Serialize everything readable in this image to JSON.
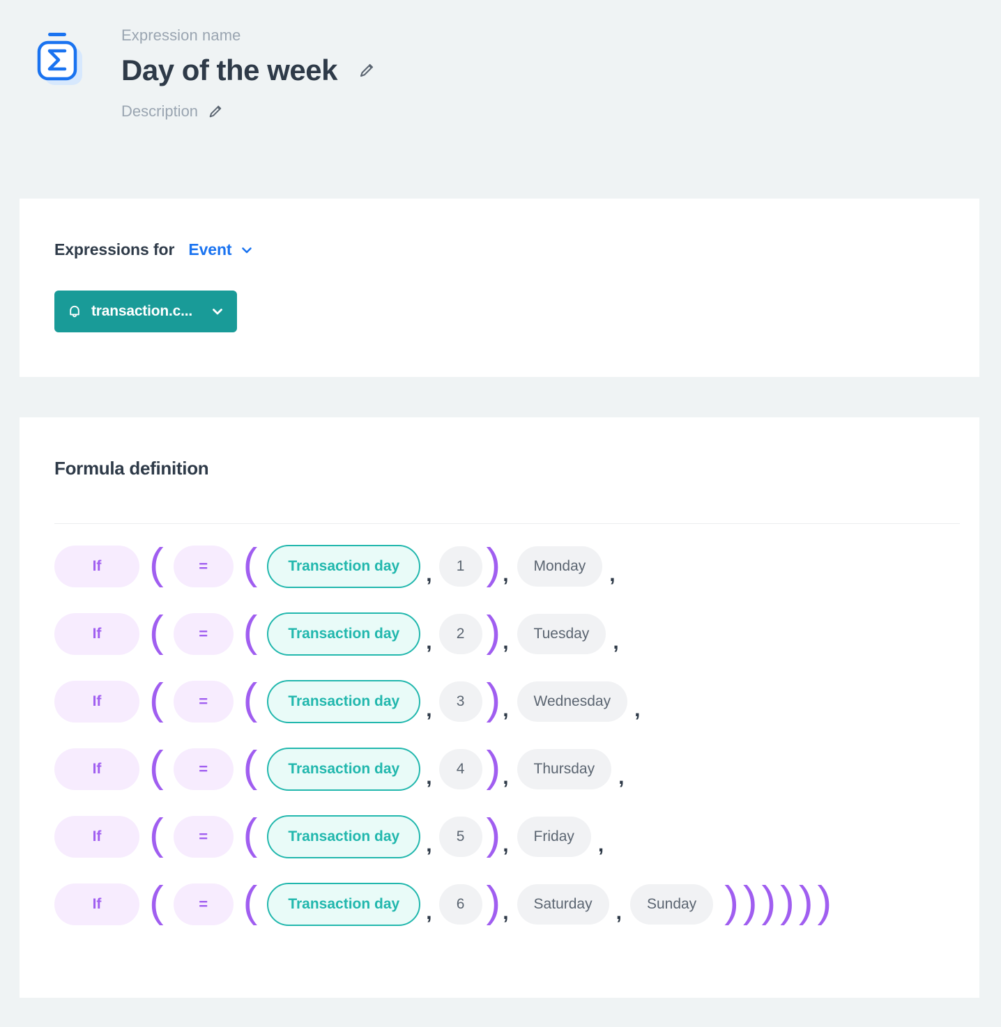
{
  "header": {
    "icon_name": "sigma-expression-icon",
    "expression_name_label": "Expression name",
    "title": "Day of the week",
    "edit_title_icon": "pencil-icon",
    "description_label": "Description",
    "edit_description_icon": "pencil-icon"
  },
  "expressions_card": {
    "label": "Expressions for",
    "scope": "Event",
    "scope_chevron": "chevron-down-icon",
    "chip": {
      "icon": "bell-icon",
      "label": "transaction.c...",
      "chevron": "chevron-down-icon"
    }
  },
  "formula_card": {
    "title": "Formula definition",
    "tokens": {
      "if": "If",
      "equals": "=",
      "field": "Transaction day",
      "open_paren": "(",
      "close_paren": ")",
      "comma": ","
    },
    "rows": [
      {
        "if": "If",
        "eq": "=",
        "field": "Transaction day",
        "value": "1",
        "result": "Monday",
        "extra": null,
        "trailing_close_parens": 0,
        "trailing_comma": true
      },
      {
        "if": "If",
        "eq": "=",
        "field": "Transaction day",
        "value": "2",
        "result": "Tuesday",
        "extra": null,
        "trailing_close_parens": 0,
        "trailing_comma": true
      },
      {
        "if": "If",
        "eq": "=",
        "field": "Transaction day",
        "value": "3",
        "result": "Wednesday",
        "extra": null,
        "trailing_close_parens": 0,
        "trailing_comma": true
      },
      {
        "if": "If",
        "eq": "=",
        "field": "Transaction day",
        "value": "4",
        "result": "Thursday",
        "extra": null,
        "trailing_close_parens": 0,
        "trailing_comma": true
      },
      {
        "if": "If",
        "eq": "=",
        "field": "Transaction day",
        "value": "5",
        "result": "Friday",
        "extra": null,
        "trailing_close_parens": 0,
        "trailing_comma": true
      },
      {
        "if": "If",
        "eq": "=",
        "field": "Transaction day",
        "value": "6",
        "result": "Saturday",
        "extra": "Sunday",
        "trailing_close_parens": 6,
        "trailing_comma": false
      }
    ]
  },
  "colors": {
    "page_background": "#eff3f4",
    "card_background": "#ffffff",
    "accent_blue": "#1a73f0",
    "accent_teal": "#199b98",
    "field_teal": "#21b7ad",
    "paren_purple": "#a05ef0",
    "pill_purple_bg": "#f7ecfe",
    "pill_gray_bg": "#f1f2f4",
    "text_dark": "#2e3a48",
    "text_muted": "#9aa5b1"
  }
}
